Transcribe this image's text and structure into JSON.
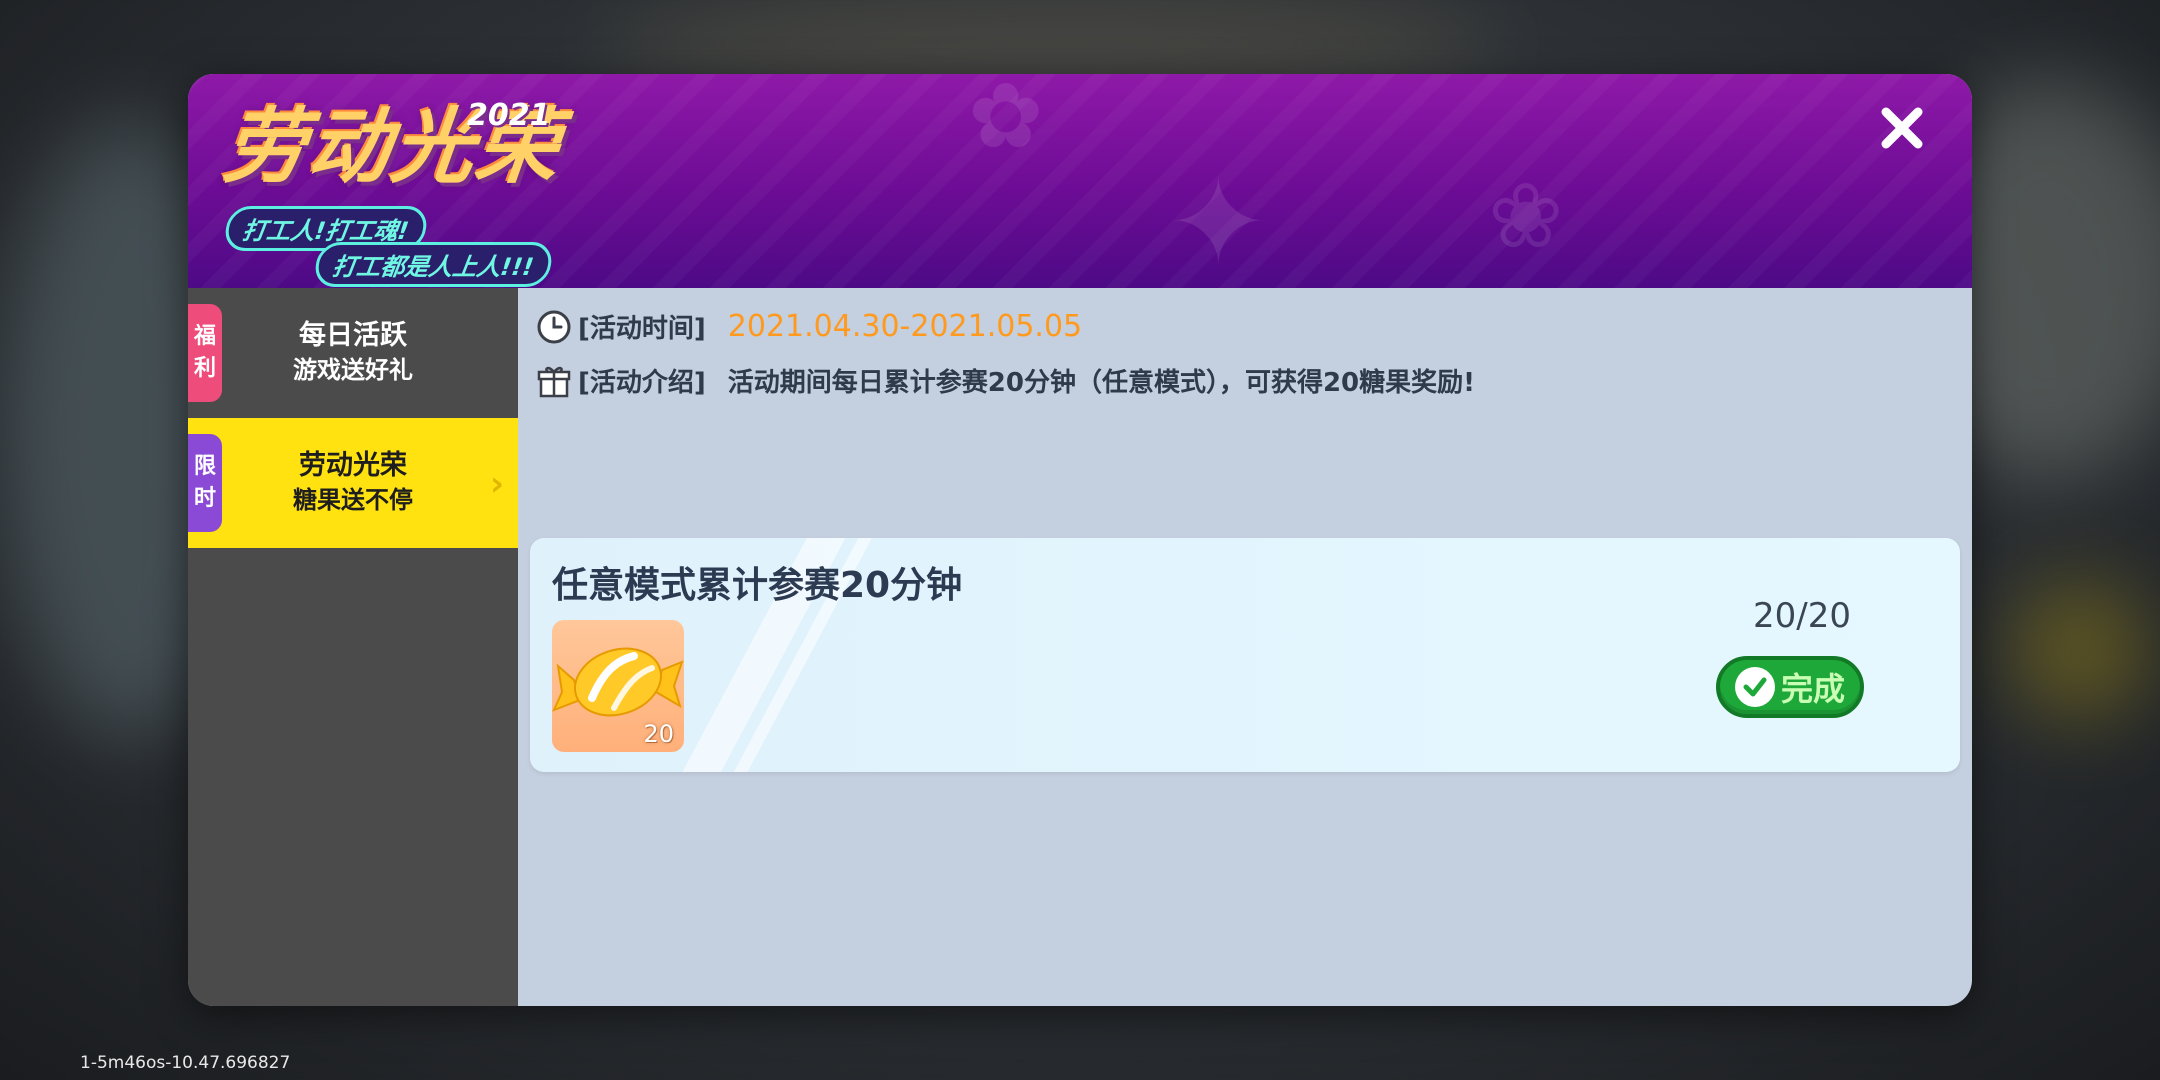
{
  "header": {
    "logo_title": "劳动光荣",
    "logo_year": "2021",
    "logo_slogan_1": "打工人!打工魂!",
    "logo_slogan_2": "打工都是人上人!!!",
    "close_icon": "close-icon"
  },
  "sidebar": {
    "items": [
      {
        "tag": [
          "福",
          "利"
        ],
        "line1": "每日活跃",
        "line2": "游戏送好礼",
        "active": false,
        "tag_color": "#ee4d7c"
      },
      {
        "tag": [
          "限",
          "时"
        ],
        "line1": "劳动光荣",
        "line2": "糖果送不停",
        "active": true,
        "tag_color": "#8a4ad6"
      }
    ]
  },
  "info": {
    "time_label": "[活动时间]",
    "time_value": "2021.04.30-2021.05.05",
    "intro_label": "[活动介绍]",
    "intro_value": "活动期间每日累计参赛20分钟（任意模式），可获得20糖果奖励!"
  },
  "task": {
    "title": "任意模式累计参赛20分钟",
    "reward_icon": "candy-icon",
    "reward_count": "20",
    "progress": "20/20",
    "status_label": "完成"
  },
  "build_tag": "1-5m46os-10.47.696827",
  "colors": {
    "header_purple": "#6c0c95",
    "active_tab": "#ffe20f",
    "date_orange": "#ff9a1f",
    "done_green": "#1fa83a"
  }
}
